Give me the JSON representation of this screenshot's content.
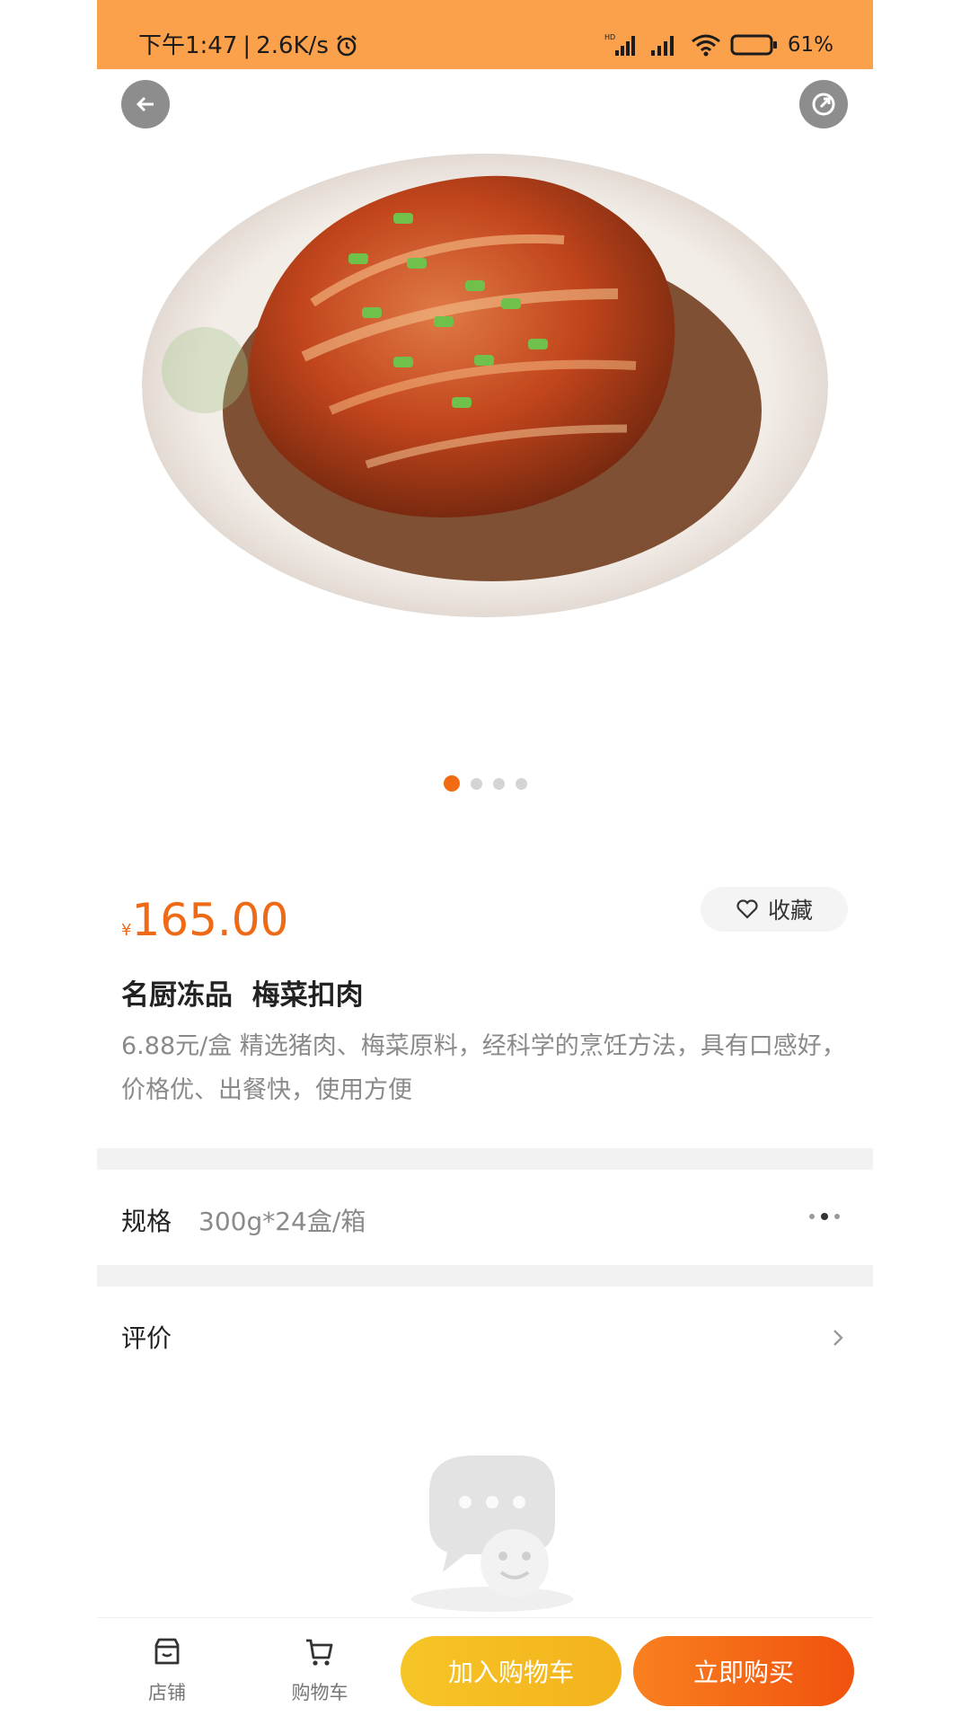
{
  "status_bar": {
    "time": "下午1:47",
    "network_speed": "2.6K/s",
    "battery": "61%"
  },
  "pager": {
    "count": 4,
    "active_index": 0
  },
  "product": {
    "currency": "¥",
    "price": "165.00",
    "favorite_label": "收藏",
    "title": "名厨冻品  梅菜扣肉",
    "description": "6.88元/盒  精选猪肉、梅菜原料，经科学的烹饪方法，具有口感好，价格优、出餐快，使用方便"
  },
  "spec": {
    "label": "规格",
    "value": "300g*24盒/箱"
  },
  "reviews": {
    "label": "评价"
  },
  "bottom_bar": {
    "shop_label": "店铺",
    "cart_label": "购物车",
    "add_to_cart_label": "加入购物车",
    "buy_now_label": "立即购买"
  },
  "colors": {
    "status_bar": "#fba04b",
    "price": "#ee6a16",
    "add_to_cart": "#f4b81f",
    "buy_now": "#f3621a"
  }
}
